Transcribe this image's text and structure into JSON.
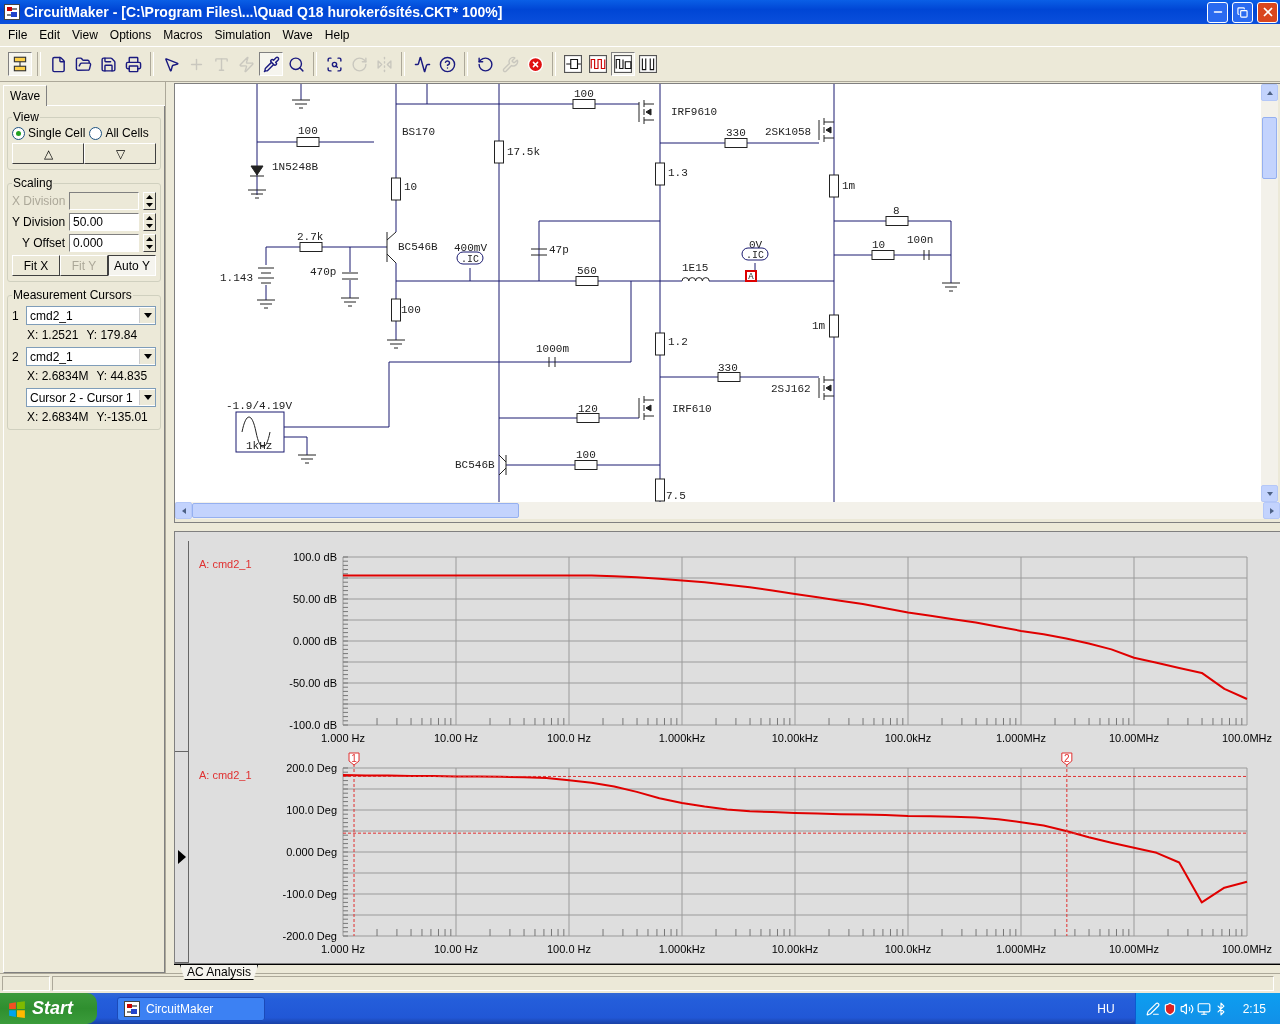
{
  "window": {
    "title": "CircuitMaker - [C:\\Program Files\\...\\Quad Q18 hurokerősítés.CKT* 100%]"
  },
  "menu": [
    "File",
    "Edit",
    "View",
    "Options",
    "Macros",
    "Simulation",
    "Wave",
    "Help"
  ],
  "toolbar": [
    {
      "kind": "panel",
      "pressed": true,
      "disabled": false
    },
    {
      "kind": "separator"
    },
    {
      "kind": "new",
      "pressed": false,
      "disabled": false
    },
    {
      "kind": "open",
      "pressed": false,
      "disabled": false
    },
    {
      "kind": "save",
      "pressed": false,
      "disabled": false
    },
    {
      "kind": "print",
      "pressed": false,
      "disabled": false
    },
    {
      "kind": "separator"
    },
    {
      "kind": "pointer",
      "pressed": false,
      "disabled": false
    },
    {
      "kind": "wire",
      "pressed": false,
      "disabled": true
    },
    {
      "kind": "text",
      "pressed": false,
      "disabled": true
    },
    {
      "kind": "zap",
      "pressed": false,
      "disabled": true
    },
    {
      "kind": "probe",
      "pressed": true,
      "disabled": false
    },
    {
      "kind": "zoom",
      "pressed": false,
      "disabled": false
    },
    {
      "kind": "separator"
    },
    {
      "kind": "fit",
      "pressed": false,
      "disabled": false
    },
    {
      "kind": "rotate",
      "pressed": false,
      "disabled": true
    },
    {
      "kind": "mirror",
      "pressed": false,
      "disabled": true
    },
    {
      "kind": "separator"
    },
    {
      "kind": "analysis",
      "pressed": false,
      "disabled": false
    },
    {
      "kind": "help",
      "pressed": false,
      "disabled": false
    },
    {
      "kind": "separator"
    },
    {
      "kind": "reset",
      "pressed": false,
      "disabled": false
    },
    {
      "kind": "wrench",
      "pressed": false,
      "disabled": true
    },
    {
      "kind": "stop",
      "pressed": false,
      "disabled": false
    },
    {
      "kind": "separator"
    },
    {
      "kind": "mode-a",
      "pressed": false,
      "disabled": false
    },
    {
      "kind": "mode-b",
      "pressed": false,
      "disabled": false
    },
    {
      "kind": "mode-c",
      "pressed": true,
      "disabled": false
    },
    {
      "kind": "mode-d",
      "pressed": false,
      "disabled": false
    }
  ],
  "wave_panel": {
    "tab": {
      "label": "Wave",
      "selected": true
    },
    "view": {
      "title": "View",
      "options": [
        {
          "label": "Single Cell",
          "selected": true
        },
        {
          "label": "All Cells",
          "selected": false
        }
      ],
      "buttons": [
        "△",
        "▽"
      ]
    },
    "scaling": {
      "title": "Scaling",
      "fields": [
        {
          "label": "X Division",
          "disabled": true
        },
        {
          "label": "Y Division",
          "value": "50.00",
          "disabled": false
        },
        {
          "label": "Y Offset",
          "value": "0.000",
          "disabled": false
        }
      ],
      "buttons": [
        {
          "label": "Fit X",
          "disabled": false,
          "pressed": false
        },
        {
          "label": "Fit Y",
          "disabled": true,
          "pressed": false
        },
        {
          "label": "Auto Y",
          "disabled": false,
          "pressed": true
        }
      ]
    },
    "cursors": {
      "title": "Measurement Cursors",
      "rows": [
        {
          "number": "1",
          "trace": "cmd2_1",
          "x": "X: 1.2521",
          "y": "Y: 179.84"
        },
        {
          "number": "2",
          "trace": "cmd2_1",
          "x": "X: 2.6834M",
          "y": "Y: 44.835"
        },
        {
          "trace": "Cursor 2 - Cursor 1",
          "x": "X: 2.6834M",
          "y": "Y:-135.01"
        }
      ]
    }
  },
  "schematic": {
    "labels": [
      {
        "text": "100",
        "kind": "label"
      },
      {
        "text": "IRF9610",
        "kind": "label"
      },
      {
        "text": "100",
        "kind": "label"
      },
      {
        "text": "BS170",
        "kind": "label"
      },
      {
        "text": "330",
        "kind": "label"
      },
      {
        "text": "2SK1058",
        "kind": "label"
      },
      {
        "text": "17.5k",
        "kind": "label"
      },
      {
        "text": "1N5248B",
        "kind": "label"
      },
      {
        "text": "1.3",
        "kind": "label"
      },
      {
        "text": "10",
        "kind": "label"
      },
      {
        "text": "1m",
        "kind": "label"
      },
      {
        "text": "8",
        "kind": "label"
      },
      {
        "text": "2.7k",
        "kind": "label"
      },
      {
        "text": "BC546B",
        "kind": "label"
      },
      {
        "text": "400mV",
        "kind": "label"
      },
      {
        "text": "47p",
        "kind": "label"
      },
      {
        "text": "0V",
        "kind": "label"
      },
      {
        "text": "10",
        "kind": "label"
      },
      {
        "text": "100n",
        "kind": "label"
      },
      {
        "text": ".IC",
        "kind": "ic"
      },
      {
        "text": ".IC",
        "kind": "ic"
      },
      {
        "text": "1.143",
        "kind": "label"
      },
      {
        "text": "470p",
        "kind": "label"
      },
      {
        "text": "560",
        "kind": "label"
      },
      {
        "text": "1E15",
        "kind": "label"
      },
      {
        "text": "A",
        "kind": "probe"
      },
      {
        "text": "100",
        "kind": "label"
      },
      {
        "text": "1m",
        "kind": "label"
      },
      {
        "text": "1.2",
        "kind": "label"
      },
      {
        "text": "1000m",
        "kind": "label"
      },
      {
        "text": "330",
        "kind": "label"
      },
      {
        "text": "2SJ162",
        "kind": "label"
      },
      {
        "text": "-1.9/4.19V",
        "kind": "label"
      },
      {
        "text": "120",
        "kind": "label"
      },
      {
        "text": "IRF610",
        "kind": "label"
      },
      {
        "text": "1kHz",
        "kind": "label"
      },
      {
        "text": "BC546B",
        "kind": "label"
      },
      {
        "text": "100",
        "kind": "label"
      },
      {
        "text": "7.5",
        "kind": "label"
      }
    ]
  },
  "waveforms": [
    {
      "selected": false,
      "chart_data": {
        "type": "line",
        "categories": [
          "1.000 Hz",
          null,
          null,
          null,
          null,
          "10.00 Hz",
          null,
          null,
          null,
          null,
          "100.0 Hz",
          null,
          null,
          null,
          null,
          "1.000kHz",
          null,
          null,
          null,
          null,
          "10.00kHz",
          null,
          null,
          null,
          null,
          "100.0kHz",
          null,
          null,
          null,
          null,
          "1.000MHz",
          null,
          null,
          null,
          null,
          "10.00MHz",
          null,
          null,
          null,
          null,
          "100.0MHz"
        ],
        "series": [
          {
            "name": "A: cmd2_1",
            "color": "#e00000",
            "values": [
              78,
              78,
              78,
              78,
              78,
              78,
              78,
              78,
              78,
              78,
              78,
              78,
              77,
              76,
              74,
              72,
              70,
              67,
              64,
              60,
              56,
              52,
              48,
              44,
              39,
              34,
              30,
              26,
              22,
              17,
              12,
              8,
              3,
              -3,
              -10,
              -20,
              -26,
              -32,
              -38,
              -57,
              -69
            ]
          }
        ],
        "ylim": [
          -100,
          100
        ],
        "grid": true,
        "yticks": [
          {
            "value": 100,
            "label": "100.0 dB"
          },
          {
            "value": 50,
            "label": "50.00 dB"
          },
          {
            "value": 0,
            "label": "0.000 dB"
          },
          {
            "value": -50,
            "label": "-50.00 dB"
          },
          {
            "value": -100,
            "label": "-100.0 dB"
          }
        ]
      }
    },
    {
      "selected": true,
      "chart_data": {
        "type": "line",
        "categories": [
          "1.000 Hz",
          null,
          null,
          null,
          null,
          "10.00 Hz",
          null,
          null,
          null,
          null,
          "100.0 Hz",
          null,
          null,
          null,
          null,
          "1.000kHz",
          null,
          null,
          null,
          null,
          "10.00kHz",
          null,
          null,
          null,
          null,
          "100.0kHz",
          null,
          null,
          null,
          null,
          "1.000MHz",
          null,
          null,
          null,
          null,
          "10.00MHz",
          null,
          null,
          null,
          null,
          "100.0MHz"
        ],
        "series": [
          {
            "name": "A: cmd2_1",
            "color": "#e00000",
            "values": [
              183,
              182,
              182,
              181,
              181,
              180,
              180,
              179,
              178,
              176,
              171,
              165,
              156,
              143,
              128,
              117,
              108,
              101,
              97,
              95,
              93,
              92,
              90,
              89,
              88,
              86,
              85,
              84,
              82,
              78,
              71,
              63,
              50,
              35,
              22,
              10,
              -2,
              -25,
              -120,
              -85,
              -71
            ]
          }
        ],
        "ylim": [
          -200,
          200
        ],
        "grid": true,
        "yticks": [
          {
            "value": 200,
            "label": "200.0 Deg"
          },
          {
            "value": 100,
            "label": "100.0 Deg"
          },
          {
            "value": 0,
            "label": "0.000 Deg"
          },
          {
            "value": -100,
            "label": "-100.0 Deg"
          },
          {
            "value": -200,
            "label": "-200.0 Deg"
          }
        ],
        "annotations": [
          "1",
          "2"
        ]
      }
    }
  ],
  "bottom_tabs": [
    {
      "label": "AC Analysis",
      "selected": true
    }
  ],
  "taskbar": {
    "start": "Start",
    "tasks": [
      {
        "label": "CircuitMaker",
        "selected": false
      }
    ],
    "language": "HU",
    "clock": "2:15"
  }
}
